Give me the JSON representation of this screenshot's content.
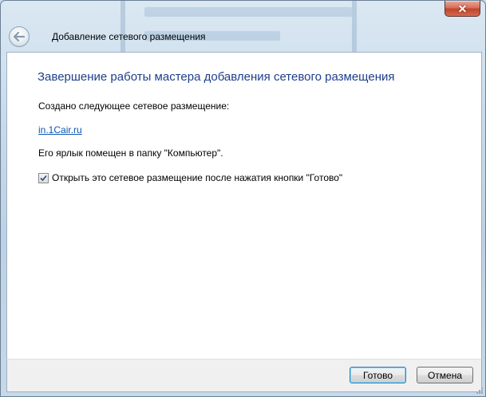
{
  "window": {
    "close_glyph": "✕"
  },
  "wizard": {
    "title": "Добавление сетевого размещения",
    "heading": "Завершение работы мастера добавления сетевого размещения",
    "created_text": "Создано следующее сетевое размещение:",
    "location_link": "in.1Cair.ru",
    "shortcut_text": "Его ярлык помещен в папку \"Компьютер\".",
    "open_checkbox": {
      "label": "Открыть это сетевое размещение после нажатия кнопки \"Готово\"",
      "checked": true
    }
  },
  "buttons": {
    "finish": "Готово",
    "cancel": "Отмена"
  },
  "colors": {
    "heading": "#1e3e8c",
    "link": "#0b56b5",
    "close": "#c0442c"
  }
}
